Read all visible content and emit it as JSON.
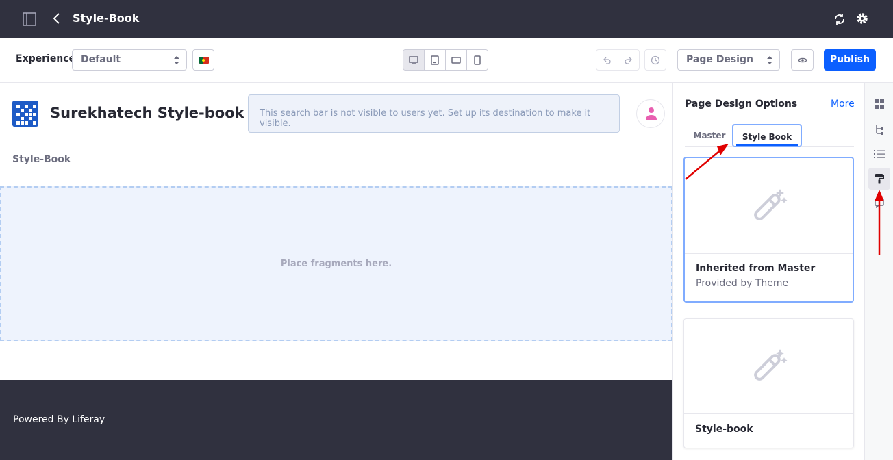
{
  "topbar": {
    "title": "Style-Book",
    "icons": [
      "sidebar-toggle-icon",
      "chevron-left-icon",
      "sync-icon",
      "gear-icon"
    ]
  },
  "toolbar": {
    "experience_label": "Experience",
    "experience_value": "Default",
    "mode_value": "Page Design",
    "publish_label": "Publish",
    "active_device": "desktop",
    "colors": {
      "publish": "#0b5fff",
      "topbar": "#30313f"
    }
  },
  "canvas": {
    "site_name": "Surekhatech Style-book",
    "search_notice": "This search bar is not visible to users yet. Set up its destination to make it visible.",
    "page_label": "Style-Book",
    "dropzone_text": "Place fragments here.",
    "footer_text": "Powered By Liferay"
  },
  "panel": {
    "title": "Page Design Options",
    "more_label": "More",
    "tabs": [
      {
        "label": "Master",
        "active": false
      },
      {
        "label": "Style Book",
        "active": true
      }
    ],
    "cards": [
      {
        "name": "Inherited from Master",
        "subtitle": "Provided by Theme",
        "selected": true
      },
      {
        "name": "Style-book",
        "subtitle": "",
        "selected": false
      }
    ]
  },
  "rail": {
    "items": [
      "fragments-icon",
      "page-structure-icon",
      "list-icon",
      "paint-roller-icon",
      "comments-icon"
    ],
    "active": "paint-roller-icon"
  }
}
